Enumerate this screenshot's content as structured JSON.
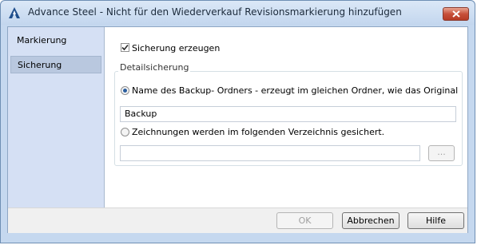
{
  "window": {
    "title": "Advance Steel - Nicht für den Wiederverkauf   Revisionsmarkierung hinzufügen"
  },
  "sidebar": {
    "items": [
      {
        "label": "Markierung",
        "selected": false
      },
      {
        "label": "Sicherung",
        "selected": true
      }
    ]
  },
  "content": {
    "enable_backup": {
      "label": "Sicherung erzeugen",
      "checked": true
    },
    "group_title": "Detailsicherung",
    "option_backup_folder": {
      "label": "Name des Backup- Ordners - erzeugt im gleichen Ordner, wie das Original",
      "selected": true
    },
    "backup_folder_value": "Backup",
    "option_directory": {
      "label": "Zeichnungen werden im folgenden Verzeichnis gesichert.",
      "selected": false
    },
    "directory_value": "",
    "browse_label": "..."
  },
  "buttons": {
    "ok": "OK",
    "cancel": "Abbrechen",
    "help": "Hilfe"
  },
  "colors": {
    "accent": "#2b5e9e",
    "close": "#c7503a",
    "sidebar": "#d5e0f4"
  }
}
